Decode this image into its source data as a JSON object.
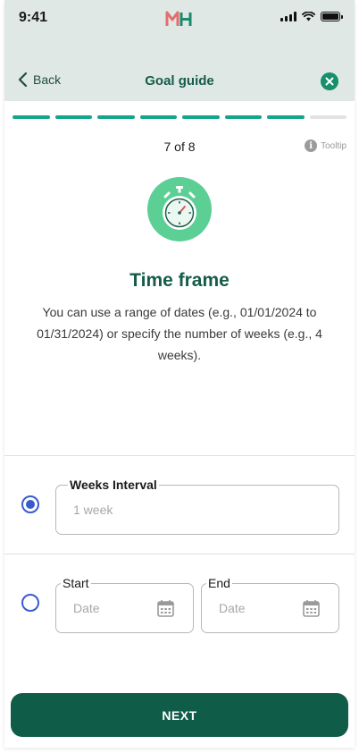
{
  "status_bar": {
    "time": "9:41",
    "logo_icon": "mh-logo-icon",
    "icons": [
      "signal-icon",
      "wifi-icon",
      "battery-icon"
    ]
  },
  "nav": {
    "back_label": "Back",
    "title": "Goal guide",
    "close_icon": "close-circle-icon"
  },
  "progress": {
    "current_step": 7,
    "total_steps": 8,
    "label": "7 of 8"
  },
  "tooltip": {
    "icon": "info-icon",
    "icon_glyph": "i",
    "label": "Tooltip"
  },
  "hero": {
    "icon": "stopwatch-icon"
  },
  "content": {
    "title": "Time frame",
    "description": "You can use a range of dates (e.g., 01/01/2024 to 01/31/2024) or specify the number of weeks (e.g., 4 weeks)."
  },
  "options": {
    "weeks": {
      "selected": true,
      "legend": "Weeks Interval",
      "value": "",
      "placeholder": "1 week"
    },
    "range": {
      "selected": false,
      "start": {
        "legend": "Start",
        "value": "",
        "placeholder": "Date",
        "icon": "calendar-icon"
      },
      "end": {
        "legend": "End",
        "value": "",
        "placeholder": "Date",
        "icon": "calendar-icon"
      }
    }
  },
  "footer": {
    "next_label": "NEXT"
  },
  "colors": {
    "brand_green": "#155c49",
    "button_green": "#0f5c49",
    "progress_done": "#14a58c",
    "progress_todo": "#e3e3e3",
    "radio_blue": "#3a5bd0",
    "hero_green": "#5ccf94",
    "header_bg": "#dfe8e5"
  }
}
